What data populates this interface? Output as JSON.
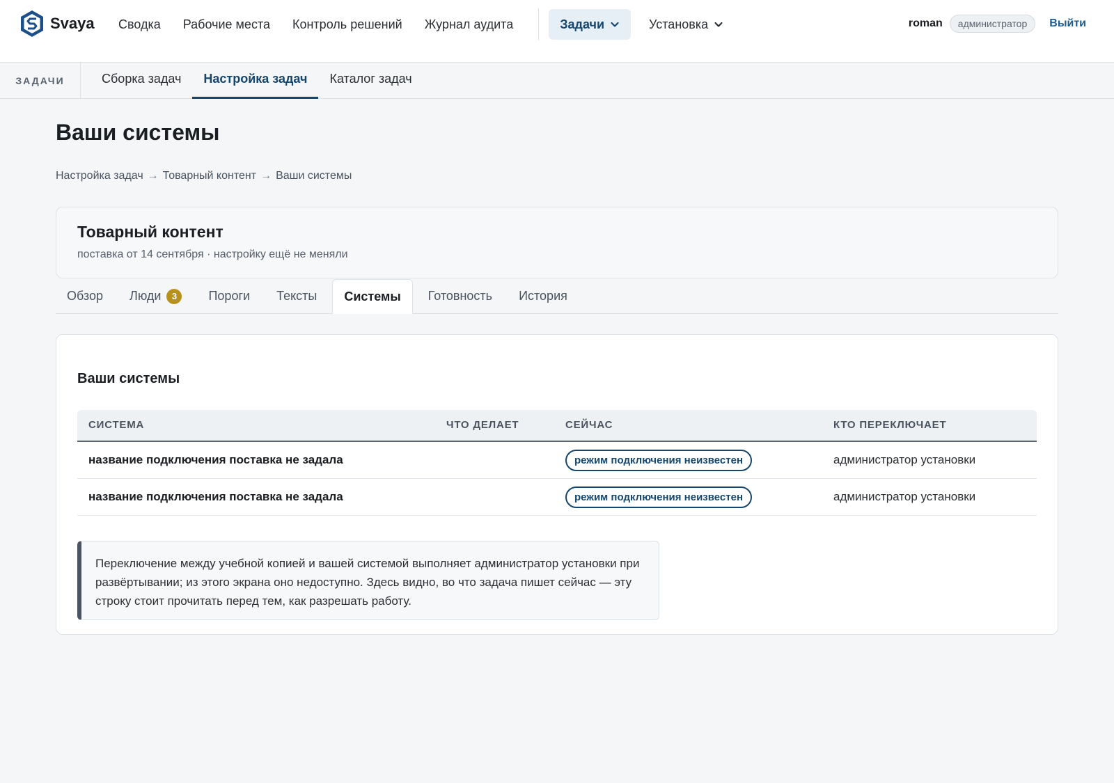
{
  "brand": {
    "name": "Svaya",
    "logo_icon": "shield-s-logo-icon"
  },
  "nav": {
    "items": [
      "Сводка",
      "Рабочие места",
      "Контроль решений",
      "Журнал аудита"
    ],
    "dropdowns": [
      {
        "label": "Задачи",
        "active": true
      },
      {
        "label": "Установка",
        "active": false
      }
    ]
  },
  "user": {
    "name": "roman",
    "role": "администратор",
    "logout": "Выйти"
  },
  "subnav": {
    "title": "ЗАДАЧИ",
    "tabs": [
      {
        "label": "Сборка задач",
        "active": false
      },
      {
        "label": "Настройка задач",
        "active": true
      },
      {
        "label": "Каталог задач",
        "active": false
      }
    ]
  },
  "page": {
    "title": "Ваши системы",
    "breadcrumb": [
      "Настройка задач",
      "Товарный контент",
      "Ваши системы"
    ],
    "breadcrumb_separator": "→"
  },
  "task": {
    "name": "Товарный контент",
    "meta": "поставка от 14 сентября · настройку ещё не меняли"
  },
  "tabs": [
    {
      "label": "Обзор"
    },
    {
      "label": "Люди",
      "badge": "3"
    },
    {
      "label": "Пороги"
    },
    {
      "label": "Тексты"
    },
    {
      "label": "Системы",
      "active": true
    },
    {
      "label": "Готовность"
    },
    {
      "label": "История"
    }
  ],
  "panel": {
    "title": "Ваши системы",
    "columns": [
      "СИСТЕМА",
      "ЧТО ДЕЛАЕТ",
      "СЕЙЧАС",
      "КТО ПЕРЕКЛЮЧАЕТ"
    ],
    "rows": [
      {
        "system": "название подключения поставка не задала",
        "does": "",
        "now": "режим подключения неизвестен",
        "who": "администратор установки"
      },
      {
        "system": "название подключения поставка не задала",
        "does": "",
        "now": "режим подключения неизвестен",
        "who": "администратор установки"
      }
    ],
    "note": "Переключение между учебной копией и вашей системой выполняет администратор установки при развёртывании; из этого экрана оно недоступно. Здесь видно, во что задача пишет сейчас — эту строку стоит прочитать перед тем, как разрешать работу."
  },
  "colors": {
    "accent": "#15466e",
    "link": "#1d5c92",
    "badge": "#b8901c",
    "background": "#f4f6f8"
  }
}
